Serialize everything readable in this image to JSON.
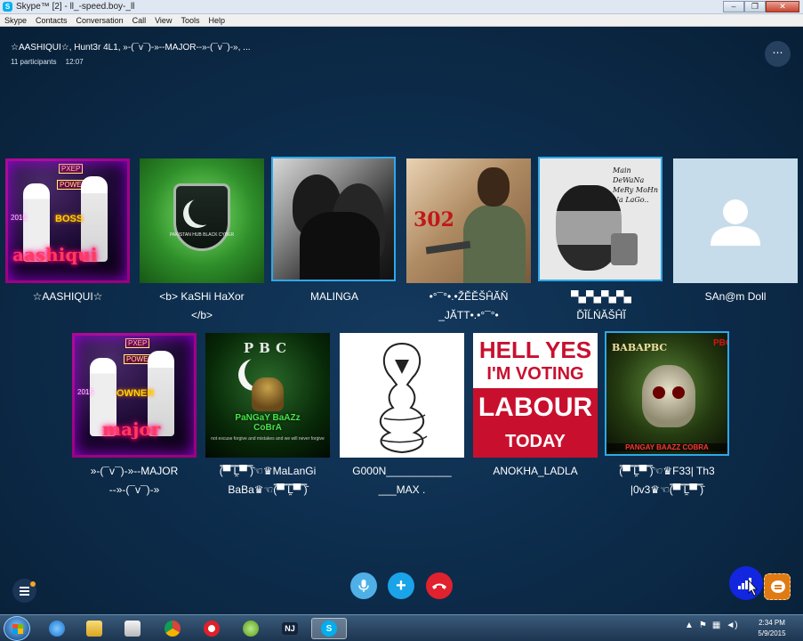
{
  "window": {
    "title": "Skype™ [2] - ll_-speed.boy-_ll",
    "controls": [
      "–",
      "❐",
      "✕"
    ]
  },
  "menu": [
    "Skype",
    "Contacts",
    "Conversation",
    "Call",
    "View",
    "Tools",
    "Help"
  ],
  "conversation": {
    "title": "☆AASHIQUI☆, Hunt3r 4L1, »-(¯v¯)-»--MAJOR--»-(¯v¯)-», ...",
    "participants": "11 participants",
    "time": "12:07",
    "more_label": "⋯"
  },
  "participants": [
    {
      "name": "☆AASHIQUI☆",
      "name2": "",
      "art": "boss",
      "selected": false
    },
    {
      "name": "<b> KaSHi HaXor",
      "name2": "</b>",
      "art": "kashi",
      "selected": false
    },
    {
      "name": "MALINGA",
      "name2": "",
      "art": "malinga",
      "selected": true
    },
    {
      "name": "•°¯°•.•ŽĚĚŠĤĂŇ",
      "name2": "_JĂTT•.•°¯°•",
      "art": "jatt",
      "selected": false
    },
    {
      "name": "▀▄▀▄▀▄▀▄",
      "name2": "ĎĨĹŃĂŠĤĨ",
      "art": "dilnashi",
      "selected": true
    },
    {
      "name": "SAn@m Doll",
      "name2": "",
      "art": "sanam",
      "selected": false
    },
    {
      "name": "»-(¯v¯)-»--MAJOR",
      "name2": "--»-(¯v¯)-»",
      "art": "owner",
      "selected": false
    },
    {
      "name": "(̿▀̿ ̿Ĺ̯̿̿▀̿ ̿)̄☜♛MaLanGi",
      "name2": "BaBa♛☜(̿▀̿ ̿Ĺ̯̿̿▀̿ ̿)̄",
      "art": "pbc",
      "selected": false
    },
    {
      "name": "G000N___________",
      "name2": "___MAX .",
      "art": "cobra",
      "selected": false
    },
    {
      "name": "ANOKHA_LADLA",
      "name2": "",
      "art": "labour",
      "selected": false
    },
    {
      "name": "(̿▀̿ ̿Ĺ̯̿̿▀̿ ̿)̄☜♛F33| Th3",
      "name2": "|0v3♛☜(̿▀̿ ̿Ĺ̯̿̿▀̿ ̿)̄",
      "art": "f33",
      "selected": true
    }
  ],
  "art_text": {
    "boss": {
      "main": "aashiqui",
      "tag": "BOSS",
      "pxp": "PXEP",
      "power": "POWER",
      "year": "2015"
    },
    "owner": {
      "main": "major",
      "tag": "OWNER",
      "pxp": "PXEP",
      "power": "POWER",
      "year": "2015"
    },
    "kashi": {
      "shield": "PAKISTAN HUB BLACK CYBER"
    },
    "jatt": {
      "num": "302"
    },
    "dilnashi": {
      "line1": "Main DeWaNa",
      "line2": "MeRy MoHn",
      "line3": "Na LaGo.."
    },
    "pbc": {
      "letters": "PBC",
      "name1": "PaNGaY BaAZz",
      "name2": "CoBrA",
      "sub": "not excuse forgive and mistakes and we will never forgive"
    },
    "labour": {
      "l1": "HELL YES",
      "l2": "I'M VOTING",
      "l3": "LABOUR",
      "l4": "TODAY"
    },
    "f33": {
      "side_left": "BABAPBC",
      "side_right": "PBC",
      "bottom": "PANGAY BAAZZ COBRA"
    }
  },
  "controls": {
    "add_label": "+"
  },
  "taskbar": {
    "time": "2:34 PM",
    "date": "5/9/2015",
    "nj_label": "NJ",
    "skype_label": "S"
  },
  "colors": {
    "background": "#0d2d4d",
    "accent": "#1aa3e8",
    "hangup": "#e0212e",
    "selected_border": "#2fa8e8",
    "chat": "#e07a12"
  }
}
